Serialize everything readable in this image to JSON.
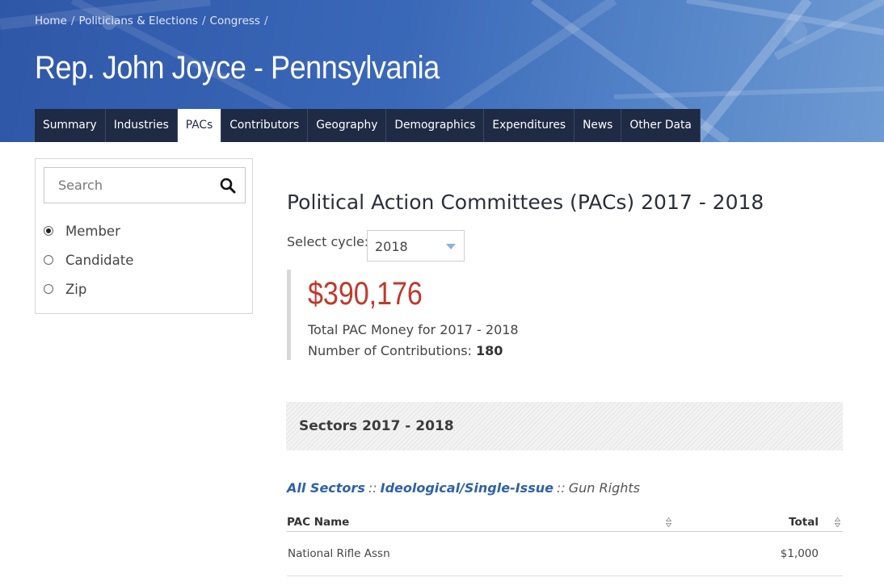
{
  "breadcrumb": [
    "Home",
    "Politicians & Elections",
    "Congress"
  ],
  "breadcrumb_separator": "/",
  "title": "Rep. John Joyce - Pennsylvania",
  "tabs": [
    {
      "label": "Summary",
      "active": false
    },
    {
      "label": "Industries",
      "active": false
    },
    {
      "label": "PACs",
      "active": true
    },
    {
      "label": "Contributors",
      "active": false
    },
    {
      "label": "Geography",
      "active": false
    },
    {
      "label": "Demographics",
      "active": false
    },
    {
      "label": "Expenditures",
      "active": false
    },
    {
      "label": "News",
      "active": false
    },
    {
      "label": "Other Data",
      "active": false
    }
  ],
  "sidebar": {
    "search_placeholder": "Search",
    "search_icon": "search-icon",
    "options": [
      {
        "label": "Member",
        "checked": true
      },
      {
        "label": "Candidate",
        "checked": false
      },
      {
        "label": "Zip",
        "checked": false
      }
    ]
  },
  "main": {
    "section_title": "Political Action Committees (PACs) 2017 - 2018",
    "select_cycle_label": "Select cycle:",
    "cycle_value": "2018",
    "amount": "$390,176",
    "total_label": "Total PAC Money for 2017 - 2018",
    "contributions_label": "Number of Contributions:",
    "contributions_count": "180",
    "sectors_title": "Sectors 2017 - 2018",
    "sector_path": {
      "all": "All Sectors",
      "mid": "Ideological/Single-Issue",
      "current": "Gun Rights",
      "separator": "::"
    },
    "table": {
      "headers": {
        "name": "PAC Name",
        "total": "Total"
      },
      "rows": [
        {
          "name": "National Rifle Assn",
          "total": "$1,000"
        }
      ]
    }
  },
  "colors": {
    "banner": "#3a68b8",
    "tab_bg": "#1f2a44",
    "amount": "#c0392b",
    "link": "#2f61a8"
  }
}
